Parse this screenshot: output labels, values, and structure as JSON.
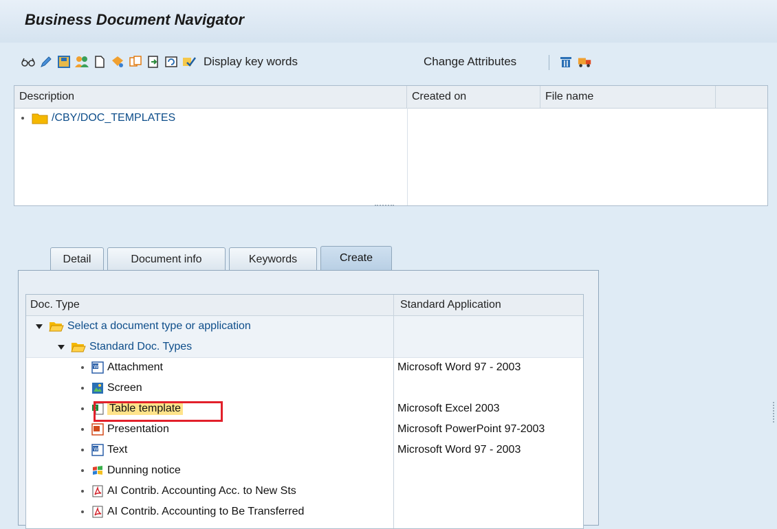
{
  "app": {
    "title": "Business Document Navigator"
  },
  "toolbar": {
    "icons": [
      "glasses-icon",
      "pencil-icon",
      "save-icon",
      "users-icon",
      "new-doc-icon",
      "paint-icon",
      "copy-icon",
      "export-icon",
      "refresh-icon",
      "check-icon",
      "trash-icon",
      "truck-icon"
    ],
    "display_key_words": "Display key words",
    "change_attributes": "Change Attributes"
  },
  "top_grid": {
    "columns": [
      "Description",
      "Created on",
      "File name"
    ],
    "rows": [
      {
        "label": "/CBY/DOC_TEMPLATES"
      }
    ]
  },
  "tabs": [
    {
      "label": "Detail",
      "active": false
    },
    {
      "label": "Document info",
      "active": false
    },
    {
      "label": "Keywords",
      "active": false
    },
    {
      "label": "Create",
      "active": true
    }
  ],
  "create_grid": {
    "columns": [
      "Doc. Type",
      "Standard Application"
    ],
    "root": "Select a document type or application",
    "group": "Standard Doc. Types",
    "items": [
      {
        "label": "Attachment",
        "icon": "word-doc-icon",
        "app": "Microsoft Word 97 - 2003"
      },
      {
        "label": "Screen",
        "icon": "image-icon",
        "app": ""
      },
      {
        "label": "Table template",
        "icon": "excel-doc-icon",
        "app": "Microsoft Excel 2003",
        "selected": true
      },
      {
        "label": "Presentation",
        "icon": "powerpoint-doc-icon",
        "app": "Microsoft PowerPoint 97-2003"
      },
      {
        "label": "Text",
        "icon": "word-doc-icon",
        "app": "Microsoft Word 97 - 2003"
      },
      {
        "label": "Dunning notice",
        "icon": "windows-icon",
        "app": ""
      },
      {
        "label": "AI Contrib. Accounting Acc. to New Sts",
        "icon": "pdf-icon",
        "app": ""
      },
      {
        "label": "AI Contrib. Accounting to Be Transferred",
        "icon": "pdf-icon",
        "app": ""
      }
    ]
  },
  "colors": {
    "accent": "#0d4d8a",
    "highlight": "#e2202a",
    "selection": "#ffe38a"
  }
}
